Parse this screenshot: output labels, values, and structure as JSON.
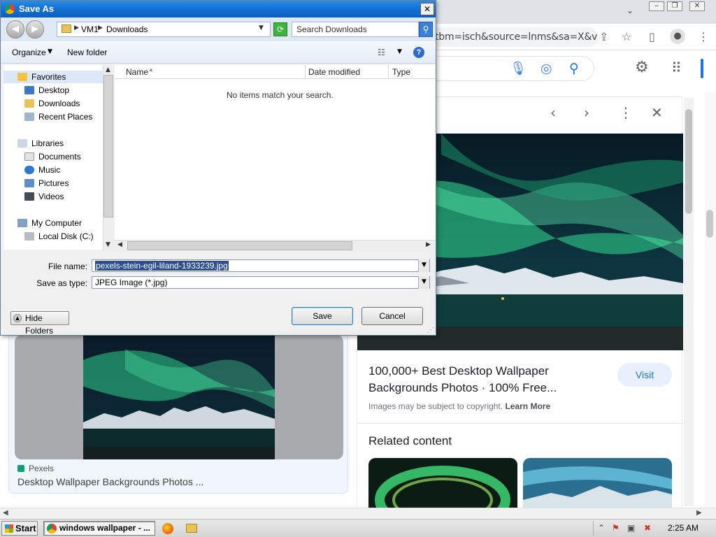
{
  "browser": {
    "url_fragment": "tbm=isch&source=lnms&sa=X&v...",
    "window_controls": [
      "‒",
      "❐",
      "✕"
    ],
    "tab_dropdown": "⌄"
  },
  "result_card": {
    "source": "Pexels",
    "title": "Desktop Wallpaper Backgrounds Photos ..."
  },
  "preview": {
    "title": "100,000+ Best Desktop Wallpaper Backgrounds Photos · 100% Free...",
    "visit_label": "Visit",
    "copyright_text": "Images may be subject to copyright.",
    "learn_more": "Learn More",
    "related_heading": "Related content"
  },
  "dialog": {
    "title": "Save As",
    "close": "✕",
    "breadcrumb": [
      "VM1",
      "Downloads"
    ],
    "search_placeholder": "Search Downloads",
    "toolbar": {
      "organize": "Organize",
      "new_folder": "New folder"
    },
    "nav_pane": {
      "favorites": "Favorites",
      "favorites_items": [
        "Desktop",
        "Downloads",
        "Recent Places"
      ],
      "libraries": "Libraries",
      "libraries_items": [
        "Documents",
        "Music",
        "Pictures",
        "Videos"
      ],
      "computer": "My Computer",
      "computer_items": [
        "Local Disk (C:)"
      ]
    },
    "columns": [
      "Name",
      "Date modified",
      "Type"
    ],
    "empty_message": "No items match your search.",
    "file_name_label": "File name:",
    "file_name_value": "pexels-stein-egil-liland-1933239.jpg",
    "save_type_label": "Save as type:",
    "save_type_value": "JPEG Image (*.jpg)",
    "save_label": "Save",
    "cancel_label": "Cancel",
    "hide_folders_label": "Hide Folders"
  },
  "taskbar": {
    "start_label": "Start",
    "active_window": "windows wallpaper - ...",
    "clock": "2:25 AM"
  },
  "colors": {
    "accent_blue": "#1a73e8",
    "aurora_green": "#2ecf8a",
    "dialog_title": "#1370d4"
  }
}
